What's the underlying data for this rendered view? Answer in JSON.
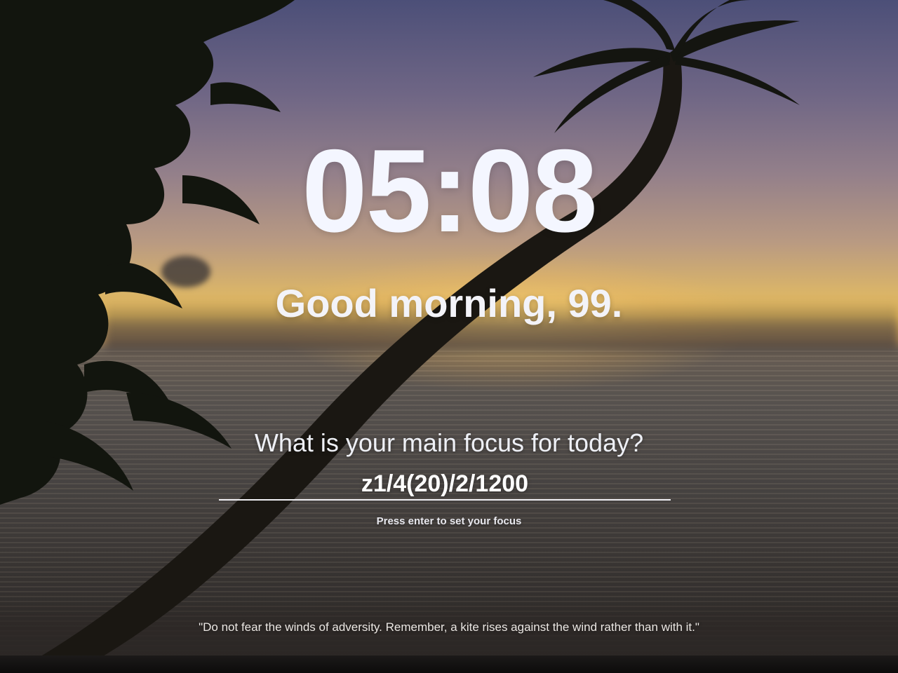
{
  "clock": {
    "time": "05:08"
  },
  "greeting": {
    "text": "Good morning, 99."
  },
  "focus": {
    "question": "What is your main focus for today?",
    "value": "z1/4(20)/2/1200",
    "hint": "Press enter to set your focus"
  },
  "quote": {
    "text": "\"Do not fear the winds of adversity. Remember, a kite rises against the wind rather than with it.\""
  },
  "colors": {
    "text": "#ffffff",
    "sky_top": "#4c4f78",
    "horizon": "#e3b85a",
    "sea": "#4a4644"
  }
}
